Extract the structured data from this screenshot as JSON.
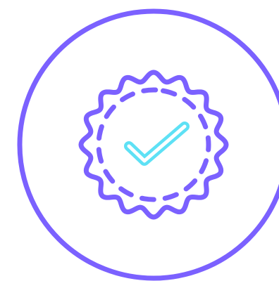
{
  "icon": {
    "name": "verified-badge-icon",
    "outer_ring": "circle-ring",
    "badge_shape": "scalloped-seal",
    "inner_ring_style": "dashed",
    "check_mark": "check-icon"
  },
  "colors": {
    "background": "#ffffff",
    "primary": "#7B61FF",
    "accent": "#5EE1F5"
  }
}
